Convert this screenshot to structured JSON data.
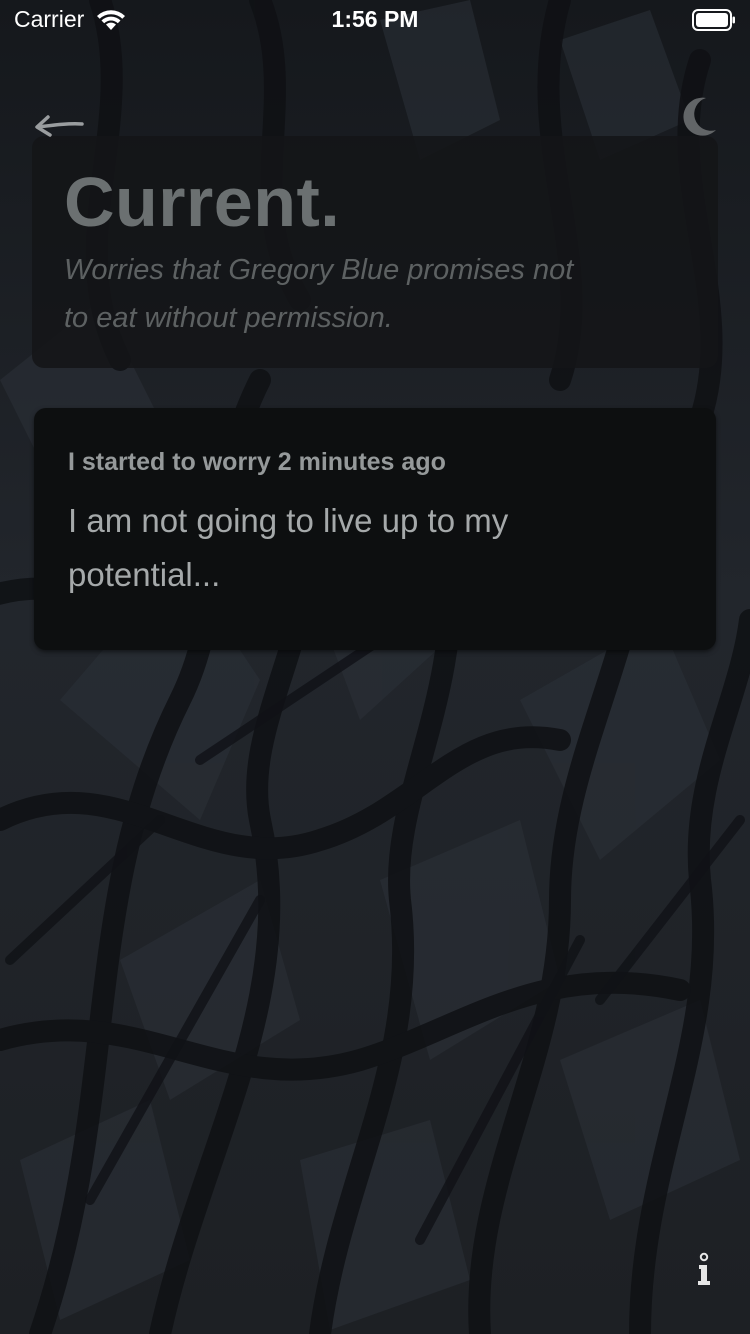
{
  "status_bar": {
    "carrier": "Carrier",
    "time": "1:56 PM",
    "wifi_icon": "wifi-icon",
    "battery_icon": "battery-icon"
  },
  "nav": {
    "back_icon": "back-arrow-icon",
    "theme_icon": "moon-icon"
  },
  "header": {
    "title": "Current.",
    "subtitle": "Worries that Gregory Blue promises not to eat without permission."
  },
  "worries": [
    {
      "started": "I started to worry 2 minutes ago",
      "text": "I am not going to live up to my potential..."
    }
  ],
  "footer": {
    "info_icon": "info-icon"
  },
  "colors": {
    "background": "#1c1f24",
    "card_background": "#0d0f10",
    "header_card_background": "#141517",
    "title_color": "#6b7071",
    "text_color": "#a5a9aa"
  }
}
